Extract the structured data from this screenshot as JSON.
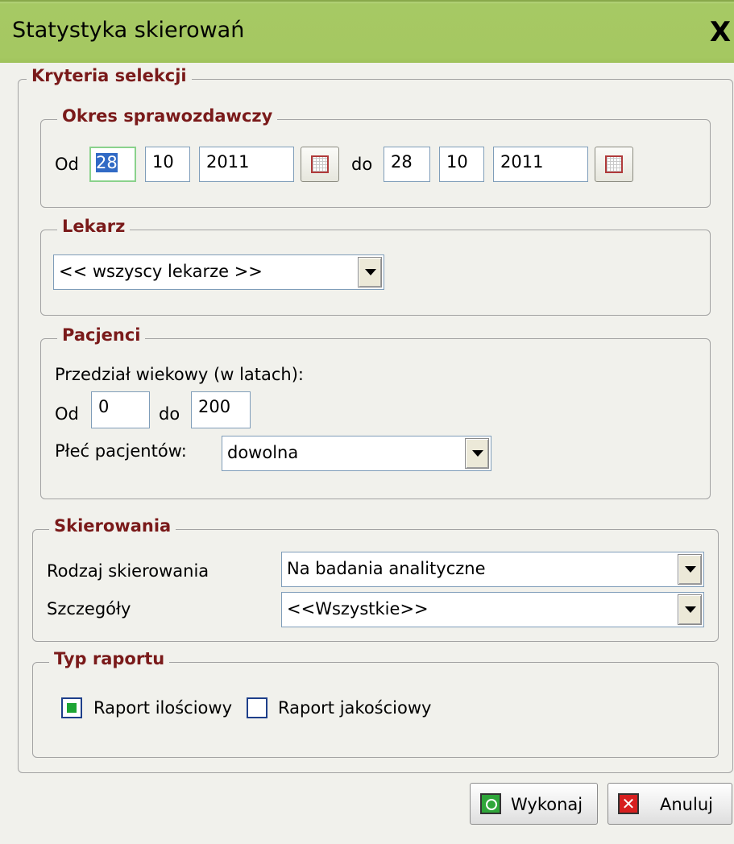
{
  "window": {
    "title": "Statystyka skierowań",
    "close_label": "X"
  },
  "criteria": {
    "legend": "Kryteria selekcji"
  },
  "period": {
    "legend": "Okres sprawozdawczy",
    "from_label": "Od",
    "from_day": "28",
    "from_month": "10",
    "from_year": "2011",
    "to_label": "do",
    "to_day": "28",
    "to_month": "10",
    "to_year": "2011"
  },
  "doctor": {
    "legend": "Lekarz",
    "selected": "<< wszyscy lekarze >>"
  },
  "patients": {
    "legend": "Pacjenci",
    "age_range_label": "Przedział wiekowy (w latach):",
    "from_label": "Od",
    "age_from": "0",
    "to_label": "do",
    "age_to": "200",
    "sex_label": "Płeć pacjentów:",
    "sex_selected": "dowolna"
  },
  "referrals": {
    "legend": "Skierowania",
    "type_label": "Rodzaj skierowania",
    "type_selected": "Na badania analityczne",
    "details_label": "Szczegóły",
    "details_selected": "<<Wszystkie>>"
  },
  "report_type": {
    "legend": "Typ raportu",
    "quantitative_label": "Raport ilościowy",
    "quantitative_checked": true,
    "qualitative_label": "Raport jakościowy",
    "qualitative_checked": false
  },
  "buttons": {
    "execute": "Wykonaj",
    "cancel": "Anuluj"
  },
  "colors": {
    "titlebar": "#a6c964",
    "legend_text": "#7a1a1a",
    "window_bg": "#f1f1ec"
  }
}
